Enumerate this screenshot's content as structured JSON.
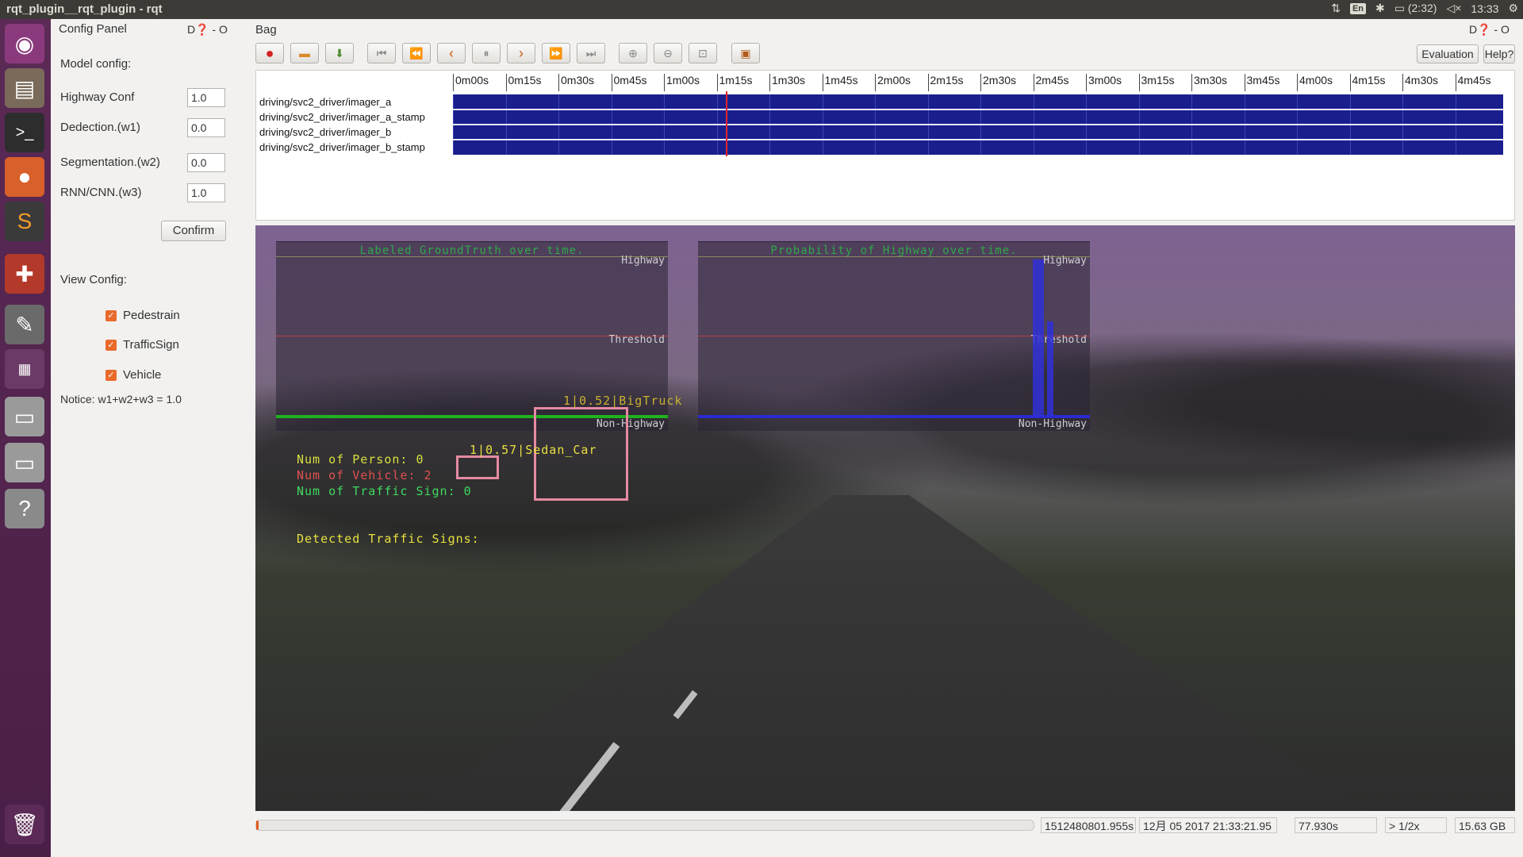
{
  "window": {
    "title": "rqt_plugin__rqt_plugin - rqt"
  },
  "tray": {
    "arrows": "⇅",
    "keyboard": "En",
    "bluetooth": "✱",
    "battery": "(2:32)",
    "volume": "◁×",
    "clock": "13:33",
    "settings": "⚙"
  },
  "launcher": {
    "items": [
      "ubuntu-icon",
      "files-icon",
      "terminal-icon",
      "firefox-icon",
      "sublime-icon",
      "settings-tools-icon",
      "text-editor-icon",
      "workspace-switcher-icon",
      "drive-icon",
      "drive-icon-2",
      "help-icon",
      "trash-icon"
    ]
  },
  "config_panel": {
    "title": "Config Panel",
    "controls": "D❓  - O",
    "model_config": "Model config:",
    "fields": [
      {
        "label": "Highway Conf",
        "value": "1.0"
      },
      {
        "label": "Dedection.(w1)",
        "value": "0.0"
      },
      {
        "label": "Segmentation.(w2)",
        "value": "0.0"
      },
      {
        "label": "RNN/CNN.(w3)",
        "value": "1.0"
      }
    ],
    "confirm_label": "Confirm",
    "view_config": "View Config:",
    "checks": [
      {
        "label": "Pedestrain",
        "checked": true
      },
      {
        "label": "TrafficSign",
        "checked": true
      },
      {
        "label": "Vehicle",
        "checked": true
      }
    ],
    "notice": "Notice:  w1+w2+w3 = 1.0"
  },
  "bag": {
    "title": "Bag",
    "controls": "D❓  - O",
    "evaluation_label": "Evaluation",
    "help_label": "Help?",
    "ticks": [
      "0m00s",
      "0m15s",
      "0m30s",
      "0m45s",
      "1m00s",
      "1m15s",
      "1m30s",
      "1m45s",
      "2m00s",
      "2m15s",
      "2m30s",
      "2m45s",
      "3m00s",
      "3m15s",
      "3m30s",
      "3m45s",
      "4m00s",
      "4m15s",
      "4m30s",
      "4m45s"
    ],
    "topics": [
      "driving/svc2_driver/imager_a",
      "driving/svc2_driver/imager_a_stamp",
      "driving/svc2_driver/imager_b",
      "driving/svc2_driver/imager_b_stamp"
    ]
  },
  "video": {
    "left_title": "Labeled GroundTruth over time.",
    "right_title": "Probability of Highway over time.",
    "highway": "Highway",
    "threshold": "Threshold",
    "non_highway": "Non-Highway",
    "det_truck": "1|0.52|BigTruck",
    "det_car": "1|0.57|Sedan_Car",
    "num_person": "Num of Person: 0",
    "num_vehicle": "Num of Vehicle: 2",
    "num_sign": "Num of Traffic Sign: 0",
    "detected_signs": "Detected Traffic Signs:"
  },
  "status": {
    "timestamp": "1512480801.955s",
    "date": "12月 05 2017 21:33:21.95",
    "elapsed": "77.930s",
    "rate": "> 1/2x",
    "size": "15.63 GB"
  }
}
